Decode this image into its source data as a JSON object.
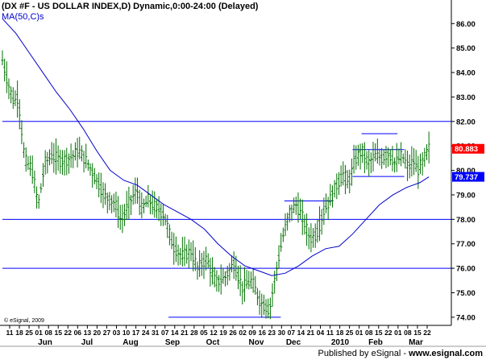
{
  "chart_title": "(DX #F - US DOLLAR INDEX,D) Dynamic,0:00-24:00 (Delayed)",
  "indicator_label": "MA(50,C)s",
  "copyright": "© eSignal, 2009",
  "footer": {
    "published_by": "Published by",
    "source": "eSignal",
    "url": "www.esignal.com"
  },
  "colors": {
    "price_bars": "#007000",
    "moving_average": "#0000cc",
    "horizontal_lines": "#0000ff",
    "last_price_badge": "#ff0000",
    "ma_badge": "#0000ff",
    "axis_frame": "#000000"
  },
  "chart_data": {
    "type": "ohlc-bar",
    "ylim": [
      73.7,
      86.7
    ],
    "y_ticks": [
      "74.00",
      "75.00",
      "76.00",
      "77.00",
      "78.00",
      "79.00",
      "80.00",
      "81.00",
      "82.00",
      "83.00",
      "84.00",
      "85.00",
      "86.00"
    ],
    "day_tick_labels": [
      "11",
      "18",
      "25",
      "01",
      "08",
      "15",
      "22",
      "06",
      "13",
      "20",
      "27",
      "03",
      "10",
      "17",
      "24",
      "31",
      "07",
      "14",
      "21",
      "28",
      "05",
      "12",
      "19",
      "26",
      "02",
      "09",
      "16",
      "23",
      "30",
      "07",
      "14",
      "21",
      "04",
      "11",
      "18",
      "25",
      "01",
      "08",
      "15",
      "22",
      "01",
      "08",
      "15",
      "22"
    ],
    "month_labels": [
      "Jun",
      "Jul",
      "Aug",
      "Sep",
      "Oct",
      "Nov",
      "Dec",
      "Feb",
      "Mar"
    ],
    "year_label": "2010",
    "last_price": "80.883",
    "ma_value": "79.737",
    "horizontal_lines": [
      82.0,
      78.0,
      76.0
    ],
    "short_lines": [
      {
        "from": 0.628,
        "to": 0.735,
        "y": 78.75
      },
      {
        "from": 0.78,
        "to": 0.895,
        "y": 80.85
      },
      {
        "from": 0.8,
        "to": 0.88,
        "y": 81.5
      },
      {
        "from": 0.78,
        "to": 0.895,
        "y": 79.75
      },
      {
        "from": 0.37,
        "to": 0.62,
        "y": 74.0
      }
    ],
    "price_path": [
      [
        0.0,
        84.5
      ],
      [
        0.012,
        83.6
      ],
      [
        0.025,
        82.8
      ],
      [
        0.035,
        83.0
      ],
      [
        0.05,
        80.4
      ],
      [
        0.065,
        80.1
      ],
      [
        0.08,
        78.6
      ],
      [
        0.095,
        80.3
      ],
      [
        0.11,
        80.6
      ],
      [
        0.13,
        80.4
      ],
      [
        0.15,
        80.5
      ],
      [
        0.17,
        80.8
      ],
      [
        0.19,
        80.3
      ],
      [
        0.21,
        79.6
      ],
      [
        0.23,
        78.9
      ],
      [
        0.25,
        78.7
      ],
      [
        0.265,
        77.9
      ],
      [
        0.28,
        78.6
      ],
      [
        0.3,
        79.2
      ],
      [
        0.31,
        78.4
      ],
      [
        0.325,
        78.8
      ],
      [
        0.34,
        78.5
      ],
      [
        0.36,
        78.2
      ],
      [
        0.38,
        76.9
      ],
      [
        0.4,
        76.5
      ],
      [
        0.42,
        76.7
      ],
      [
        0.435,
        76.0
      ],
      [
        0.455,
        76.4
      ],
      [
        0.475,
        75.4
      ],
      [
        0.495,
        75.6
      ],
      [
        0.515,
        76.2
      ],
      [
        0.535,
        75.2
      ],
      [
        0.555,
        75.5
      ],
      [
        0.575,
        74.6
      ],
      [
        0.595,
        74.3
      ],
      [
        0.61,
        75.9
      ],
      [
        0.625,
        77.3
      ],
      [
        0.64,
        78.3
      ],
      [
        0.655,
        78.6
      ],
      [
        0.67,
        78.0
      ],
      [
        0.685,
        77.2
      ],
      [
        0.7,
        77.4
      ],
      [
        0.715,
        78.3
      ],
      [
        0.73,
        78.8
      ],
      [
        0.745,
        79.4
      ],
      [
        0.76,
        79.9
      ],
      [
        0.77,
        79.4
      ],
      [
        0.785,
        80.4
      ],
      [
        0.8,
        80.8
      ],
      [
        0.815,
        80.3
      ],
      [
        0.83,
        80.6
      ],
      [
        0.845,
        80.5
      ],
      [
        0.86,
        80.7
      ],
      [
        0.875,
        80.3
      ],
      [
        0.89,
        80.6
      ],
      [
        0.905,
        80.1
      ],
      [
        0.915,
        80.4
      ],
      [
        0.925,
        80.0
      ],
      [
        0.935,
        80.3
      ],
      [
        0.95,
        80.9
      ]
    ],
    "ma_path": [
      [
        0.0,
        86.2
      ],
      [
        0.03,
        85.6
      ],
      [
        0.06,
        84.8
      ],
      [
        0.09,
        84.0
      ],
      [
        0.12,
        83.2
      ],
      [
        0.15,
        82.5
      ],
      [
        0.18,
        81.7
      ],
      [
        0.21,
        80.8
      ],
      [
        0.24,
        80.0
      ],
      [
        0.27,
        79.6
      ],
      [
        0.3,
        79.4
      ],
      [
        0.33,
        79.0
      ],
      [
        0.36,
        78.6
      ],
      [
        0.39,
        78.3
      ],
      [
        0.42,
        78.0
      ],
      [
        0.45,
        77.6
      ],
      [
        0.48,
        77.0
      ],
      [
        0.51,
        76.5
      ],
      [
        0.54,
        76.1
      ],
      [
        0.57,
        75.9
      ],
      [
        0.6,
        75.7
      ],
      [
        0.63,
        75.8
      ],
      [
        0.66,
        76.1
      ],
      [
        0.69,
        76.5
      ],
      [
        0.72,
        76.8
      ],
      [
        0.75,
        76.9
      ],
      [
        0.78,
        77.4
      ],
      [
        0.81,
        78.0
      ],
      [
        0.84,
        78.6
      ],
      [
        0.87,
        79.0
      ],
      [
        0.9,
        79.3
      ],
      [
        0.93,
        79.5
      ],
      [
        0.95,
        79.737
      ]
    ]
  }
}
